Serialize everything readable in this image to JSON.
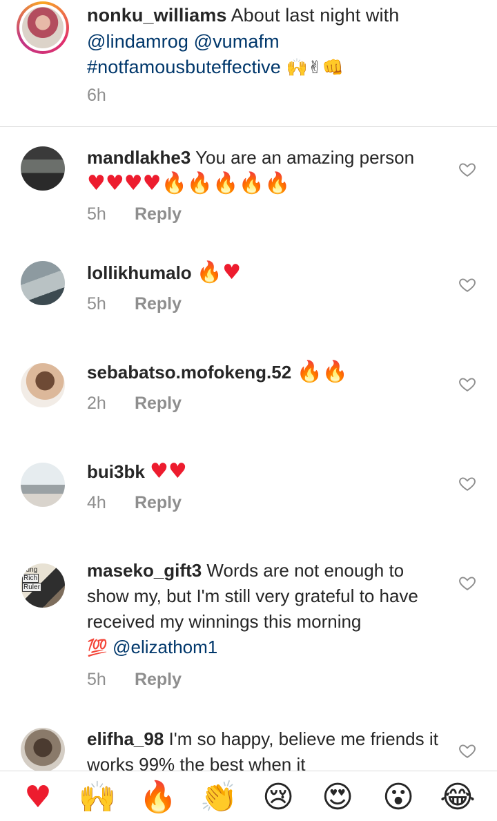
{
  "caption": {
    "username": "nonku_williams",
    "text": "About last night with",
    "mentions": [
      "@lindamrog",
      "@vumafm"
    ],
    "hashtag": "#notfamousbuteffective",
    "emojis": "🙌✌👊",
    "time": "6h"
  },
  "comments": [
    {
      "username": "mandlakhe3",
      "text": "You are an amazing person",
      "emoji_line": "♥♥♥♥🔥🔥🔥🔥🔥",
      "time": "5h",
      "reply_label": "Reply"
    },
    {
      "username": "lollikhumalo",
      "emoji_line": "🔥♥",
      "time": "5h",
      "reply_label": "Reply"
    },
    {
      "username": "sebabatso.mofokeng.52",
      "emoji_line": "🔥🔥",
      "time": "2h",
      "reply_label": "Reply"
    },
    {
      "username": "bui3bk",
      "emoji_line": "♥♥",
      "time": "4h",
      "reply_label": "Reply"
    },
    {
      "username": "maseko_gift3",
      "text": "Words are not enough to show my, but I'm still very grateful to have received my winnings this morning",
      "emoji": "💯",
      "mention": "@elizathom1",
      "time": "5h",
      "reply_label": "Reply",
      "avatar_text": [
        "oung",
        "Rich",
        "Ruler"
      ]
    },
    {
      "username": "elifha_98",
      "text": "I'm so happy, believe me friends it works 99% the best when it"
    }
  ],
  "quick_reactions": [
    "♥",
    "🙌",
    "🔥",
    "👏",
    "😢",
    "😍",
    "😮",
    "😂"
  ],
  "colors": {
    "mention": "#00376b",
    "meta": "#8e8e8e",
    "heart": "#ed1c2e",
    "divider": "#dbdbdb"
  }
}
